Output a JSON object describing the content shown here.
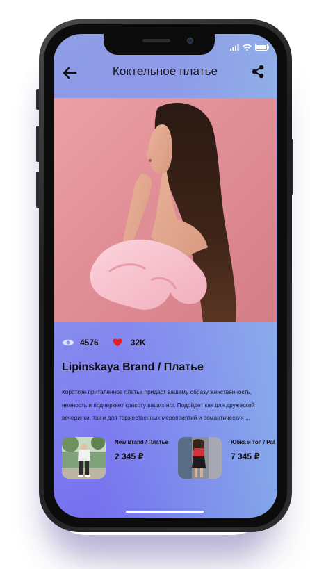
{
  "header": {
    "title": "Коктельное платье"
  },
  "stats": {
    "views": "4576",
    "likes": "32K"
  },
  "product": {
    "title": "Lipinskaya Brand / Платье",
    "description": "Короткое приталенное платье придаст вашему образу женственность, нежность и подчеркнет красоту ваших ног. Подойдет как для дружеской вечеринки, так и для торжественных мероприятий и романтических ..."
  },
  "related": [
    {
      "name": "New Brand / Платье",
      "price": "2 345 ₽"
    },
    {
      "name": "Юбка и топ / Pal",
      "price": "7 345 ₽"
    }
  ],
  "icons": {
    "back": "arrow-left-icon",
    "share": "share-icon",
    "views": "eye-icon",
    "likes": "heart-icon",
    "signal": "signal-icon",
    "wifi": "wifi-icon",
    "battery": "battery-icon"
  },
  "colors": {
    "gradient_start": "#8f9ce6",
    "gradient_end": "#6f66ee",
    "heart": "#e31e24",
    "hero_background": "#e18f97"
  }
}
